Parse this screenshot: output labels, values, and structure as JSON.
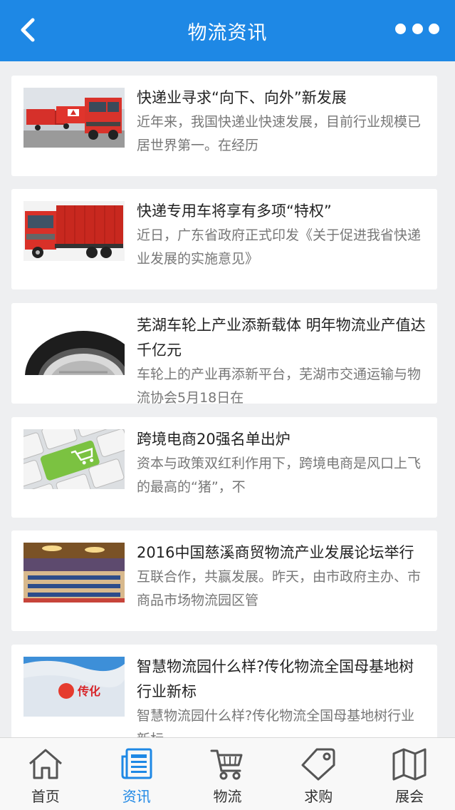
{
  "header": {
    "title": "物流资讯",
    "back_icon": "chevron-left-icon",
    "more_icon": "more-dots-icon"
  },
  "articles": [
    {
      "title": "快递业寻求“向下、向外”新发展",
      "summary": "近年来，我国快递业快速发展，目前行业规模已居世界第一。在经历",
      "image": "red-trucks-fleet"
    },
    {
      "title": "快递专用车将享有多项“特权”",
      "summary": "近日，广东省政府正式印发《关于促进我省快递业发展的实施意见》",
      "image": "red-container-truck"
    },
    {
      "title": "芜湖车轮上产业添新载体 明年物流业产值达千亿元",
      "summary": "车轮上的产业再添新平台，芜湖市交通运输与物流协会5月18日在",
      "image": "car-wheel"
    },
    {
      "title": "跨境电商20强名单出炉",
      "summary": "资本与政策双红利作用下，跨境电商是风口上飞的最高的“猪”，不",
      "image": "keyboard-shopping-key"
    },
    {
      "title": "2016中国慈溪商贸物流产业发展论坛举行",
      "summary": "互联合作，共赢发展。昨天，由市政府主办、市商品市场物流园区管",
      "image": "conference-hall"
    },
    {
      "title": "智慧物流园什么样?传化物流全国母基地树行业新标",
      "summary": "智慧物流园什么样?传化物流全国母基地树行业新标",
      "image": "transfar-flag",
      "logo_text": "传化"
    }
  ],
  "tabbar": [
    {
      "label": "首页",
      "icon": "home-icon",
      "active": false
    },
    {
      "label": "资讯",
      "icon": "news-icon",
      "active": true
    },
    {
      "label": "物流",
      "icon": "cart-icon",
      "active": false
    },
    {
      "label": "求购",
      "icon": "tag-icon",
      "active": false
    },
    {
      "label": "展会",
      "icon": "map-icon",
      "active": false
    }
  ],
  "colors": {
    "primary": "#1e88e5",
    "background": "#eeeff1",
    "title_text": "#222222",
    "summary_text": "#777777"
  }
}
